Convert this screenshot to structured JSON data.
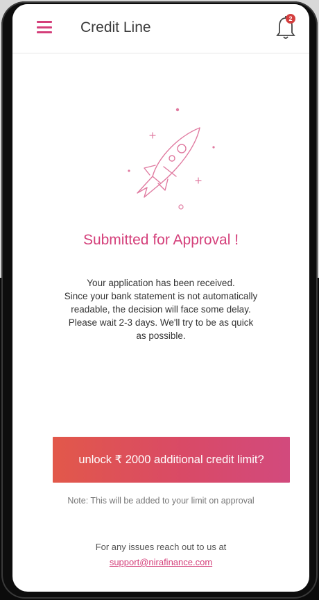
{
  "appbar": {
    "title": "Credit Line",
    "menu_icon": "hamburger-menu-icon",
    "notifications_icon": "bell-icon",
    "notification_count": "2"
  },
  "status": {
    "illustration": "rocket-icon",
    "title": "Submitted for Approval !",
    "body_lines": [
      "Your application has been received.",
      "Since your bank statement is not automatically",
      "readable, the decision will face some delay.",
      "Please wait 2-3 days. We'll try to be as quick",
      "as possible."
    ]
  },
  "cta": {
    "label": "unlock ₹ 2000 additional credit limit?",
    "note": "Note: This will be added to your limit on approval"
  },
  "support": {
    "text": "For any issues reach out to us at",
    "email": "support@nirafinance.com"
  },
  "colors": {
    "accent": "#d43f7a",
    "cta_gradient_start": "#e2584a",
    "cta_gradient_end": "#d24a7d",
    "badge": "#d43f3f"
  }
}
